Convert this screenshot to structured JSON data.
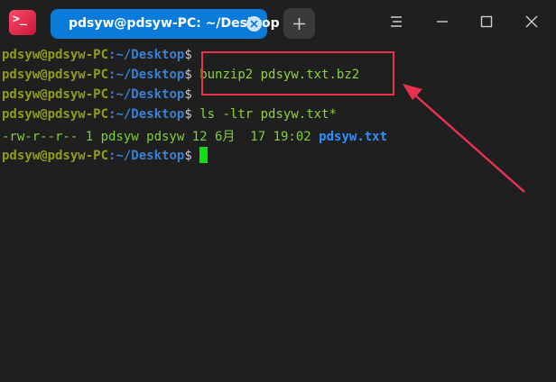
{
  "app": {
    "icon_text": ">_"
  },
  "tab": {
    "title": "pdsyw@pdsyw-PC: ~/Desktop"
  },
  "prompt": {
    "user": "pdsyw@pdsyw-PC",
    "path": ":~/Desktop",
    "dollar": "$"
  },
  "lines": [
    {
      "cmd": ""
    },
    {
      "cmd": "bunzip2 pdsyw.txt.bz2"
    },
    {
      "cmd": ""
    },
    {
      "cmd": "ls -ltr pdsyw.txt*"
    }
  ],
  "output": {
    "perms": "-rw-r--r-- 1 pdsyw pdsyw 12 6月  17 19:02",
    "file": "pdsyw.txt"
  },
  "last_prompt": {
    "cmd": ""
  },
  "colors": {
    "accent": "#0a7bd8",
    "highlight": "#e8304f",
    "cursor": "#10e010"
  }
}
